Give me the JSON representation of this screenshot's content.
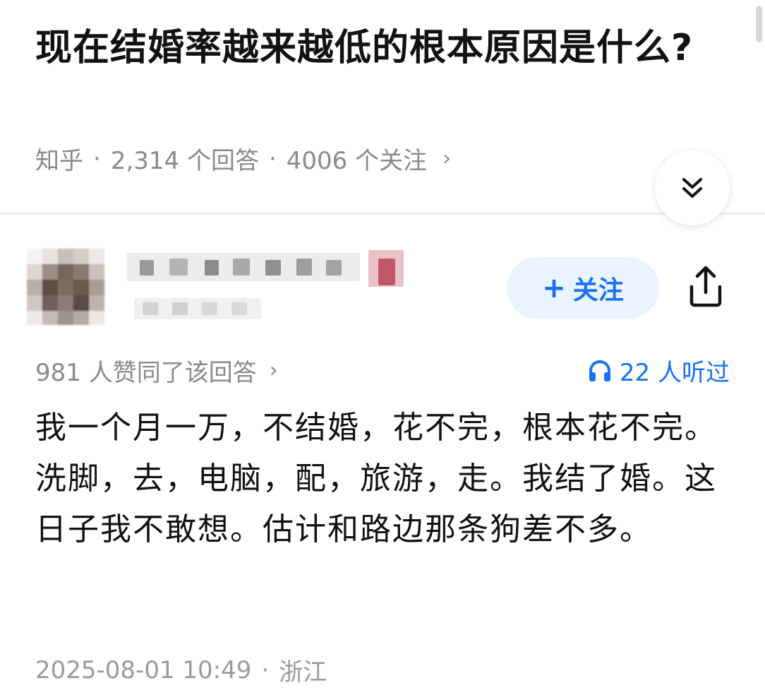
{
  "question": {
    "title": "现在结婚率越来越低的根本原因是什么?"
  },
  "meta": {
    "source": "知乎",
    "answers": "2,314 个回答",
    "followers": "4006 个关注",
    "separator": "·",
    "chevron": "›"
  },
  "answer": {
    "follow_label": "关注",
    "follow_plus": "+",
    "upvotes": "981 人赞同了该回答",
    "listened": "22 人听过",
    "chevron": "›",
    "text": "我一个月一万，不结婚，花不完，根本花不完。洗脚，去，电脑，配，旅游，走。我结了婚。这日子我不敢想。估计和路边那条狗差不多。",
    "date": "2025-08-01 10:49",
    "separator": "·",
    "location": "浙江"
  },
  "icons": {
    "collapse": "double-chevron-down-icon",
    "share": "share-icon",
    "headphones": "headphones-icon"
  },
  "colors": {
    "accent": "#1772f6",
    "follow_bg": "#ebf3fe",
    "meta_gray": "#8a8a8a",
    "title": "#121212"
  }
}
